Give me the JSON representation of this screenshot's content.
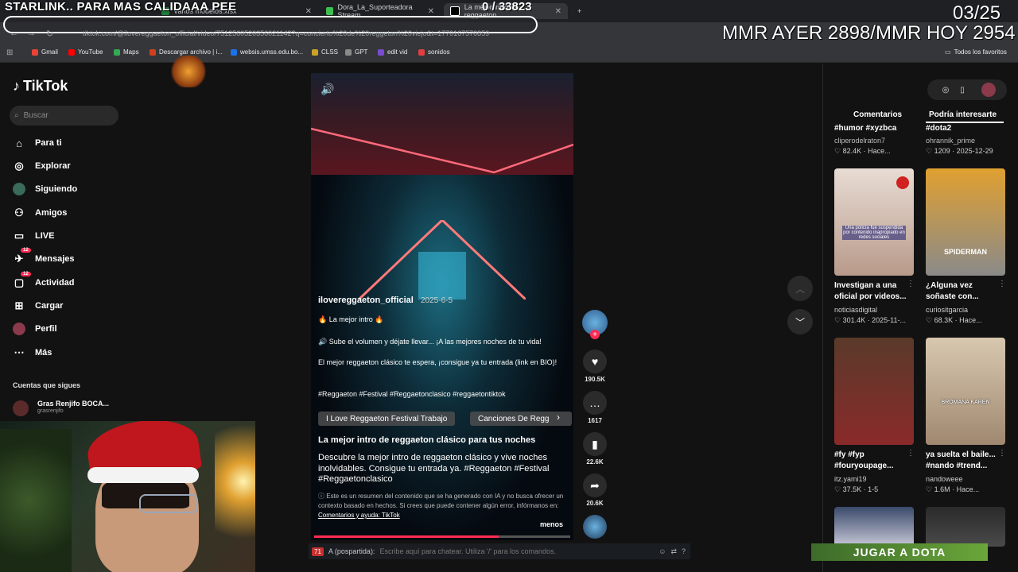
{
  "overlay": {
    "stream_title": "STARLINK.. PARA MAS CALIDAAA PEE",
    "counter": "0 / 33823",
    "date": "03/25",
    "mmr": "MMR AYER 2898/MMR HOY 2954"
  },
  "browser": {
    "tabs": [
      {
        "label": "varios modelos.xlsx",
        "color": "#1e7d3a"
      },
      {
        "label": "Dora_La_Suporteadora Stream",
        "color": "#3fbf52"
      },
      {
        "label": "La mejor intro de reggaeton",
        "color": "#000000"
      }
    ],
    "url": "tiktok.com/@ilovereggaeton_official/video/7512560520356021142?q=concierto%20de%20reggeton%20viejo&t=1770167570859",
    "bookmarks": [
      {
        "label": "Gmail",
        "color": "#ea4335"
      },
      {
        "label": "YouTube",
        "color": "#ff0000"
      },
      {
        "label": "Maps",
        "color": "#34a853"
      },
      {
        "label": "Descargar archivo | i...",
        "color": "#d04020"
      },
      {
        "label": "websis.umss.edu.bo...",
        "color": "#1a73e8"
      },
      {
        "label": "CLSS",
        "color": "#c9a227"
      },
      {
        "label": "GPT",
        "color": "#8a8a8a"
      },
      {
        "label": "edit vid",
        "color": "#7a4bd0"
      },
      {
        "label": "sonidos",
        "color": "#e04040"
      }
    ],
    "all_bookmarks": "Todos los favoritos"
  },
  "sidebar": {
    "logo": "TikTok",
    "search_placeholder": "Buscar",
    "items": [
      {
        "label": "Para ti"
      },
      {
        "label": "Explorar"
      },
      {
        "label": "Siguiendo"
      },
      {
        "label": "Amigos"
      },
      {
        "label": "LIVE"
      },
      {
        "label": "Mensajes",
        "badge": "12"
      },
      {
        "label": "Actividad",
        "badge": "12"
      },
      {
        "label": "Cargar"
      },
      {
        "label": "Perfil"
      },
      {
        "label": "Más"
      }
    ],
    "following_title": "Cuentas que sigues",
    "following": {
      "name": "Gras Renjifo BOCA...",
      "handle": "grasrenjifo"
    }
  },
  "video": {
    "author": "ilovereggaeton_official",
    "date": "2025-6-5",
    "caption_title": "🔥 La mejor intro 🔥",
    "caption_line1": "🔊 Sube el volumen y déjate llevar... ¡A las mejores noches de tu vida!",
    "caption_line2": "El mejor reggaeton clásico te espera, ¡consigue ya tu entrada (link en BIO)!",
    "hashtags": "#Reggaeton #Festival #Reggaetonclasico #reggaetontiktok",
    "chips": [
      "I Love Reggaeton Festival Trabajo",
      "Canciones De Regg"
    ],
    "summary_title": "La mejor intro de reggaeton clásico para tus noches",
    "summary_body": "Descubre la mejor intro de reggaeton clásico y vive noches inolvidables. Consigue tu entrada ya. #Reggaeton #Festival #Reggaetonclasico",
    "ai_note": "Este es un resumen del contenido que se ha generado con IA y no busca ofrecer un contexto basado en hechos. Si crees que puede contener algún error, infórmanos en:",
    "ai_link": "Comentarios y ayuda: TikTok",
    "less": "menos",
    "progress": 0.72
  },
  "actions": {
    "likes": "190.5K",
    "comments": "1617",
    "saves": "22.6K",
    "shares": "20.6K"
  },
  "right_panel": {
    "tab_comments": "Comentarios",
    "tab_suggested": "Podría interesarte",
    "cards": [
      {
        "title": "#humor #xyzbca",
        "user": "cliperodelraton7",
        "stats": "♡ 82.4K · Hace..."
      },
      {
        "title": "#dota2",
        "user": "ohrannik_prime",
        "stats": "♡ 1209 · 2025-12-29"
      },
      {
        "title": "Investigan a una oficial por videos...",
        "user": "noticiasdigital",
        "stats": "♡ 301.4K · 2025-11-...",
        "thumb_text": "Una policía fue suspendida por contenido inapropiado en redes sociales",
        "color": "#d8c8c0"
      },
      {
        "title": "¿Alguna vez soñaste con...",
        "user": "curiositgarcia",
        "stats": "♡ 68.3K · Hace...",
        "thumb_text": "SPIDERMAN",
        "color": "#e0a030"
      },
      {
        "title": "#fy #fyp #fouryoupage...",
        "user": "itz.yami19",
        "stats": "♡ 37.5K · 1-5",
        "color": "#6a3a2a"
      },
      {
        "title": "ya suelta el baile... #nando #trend...",
        "user": "nandoweee",
        "stats": "♡ 1.6M · Hace...",
        "thumb_text": "BROMANA KAREN",
        "color": "#c8b8a0"
      }
    ]
  },
  "chat": {
    "count": "71",
    "prefix": "A (pospartida):",
    "placeholder": "Escribe aquí para chatear. Utiliza '/' para los comandos."
  },
  "game_banner": "JUGAR A DOTA"
}
